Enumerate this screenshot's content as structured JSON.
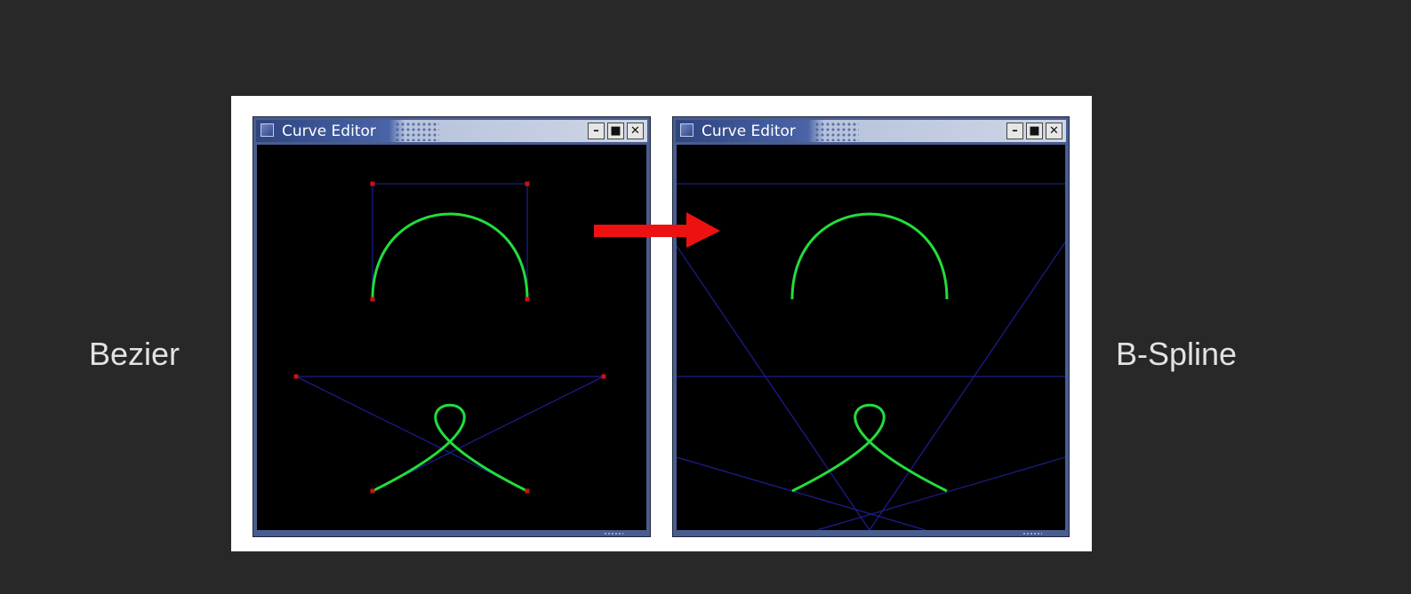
{
  "labels": {
    "left": "Bezier",
    "right": "B-Spline"
  },
  "windows": [
    {
      "title": "Curve Editor",
      "mode": "Bezier",
      "buttons": {
        "minimize": "–",
        "maximize": "■",
        "close": "✕"
      }
    },
    {
      "title": "Curve Editor",
      "mode": "B-Spline",
      "buttons": {
        "minimize": "–",
        "maximize": "■",
        "close": "✕"
      }
    }
  ],
  "colors": {
    "curve": "#22dd3c",
    "control_polygon": "#1c1c8c",
    "control_point": "#cc1111",
    "arrow": "#ee1111",
    "canvas": "#000000",
    "background": "#282828"
  },
  "icons": {
    "window": "window-icon",
    "arrow": "right-arrow-icon",
    "minimize": "minimize-icon",
    "maximize": "maximize-icon",
    "close": "close-icon"
  }
}
